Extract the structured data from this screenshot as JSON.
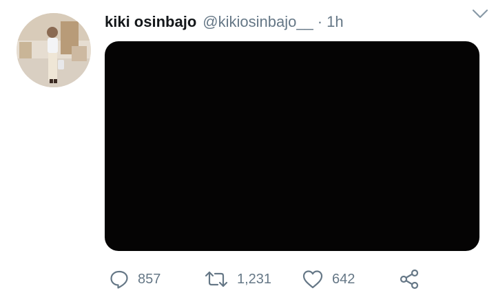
{
  "tweet": {
    "display_name": "kiki osinbajo",
    "handle": "@kikiosinbajo__",
    "separator": "·",
    "time": "1h"
  },
  "actions": {
    "reply_count": "857",
    "retweet_count": "1,231",
    "like_count": "642"
  },
  "icons": {
    "caret": "chevron-down-icon",
    "reply": "comment-icon",
    "retweet": "retweet-icon",
    "like": "heart-icon",
    "share": "share-icon"
  },
  "colors": {
    "text_primary": "#14171a",
    "text_secondary": "#657786",
    "media_background": "#050404"
  }
}
